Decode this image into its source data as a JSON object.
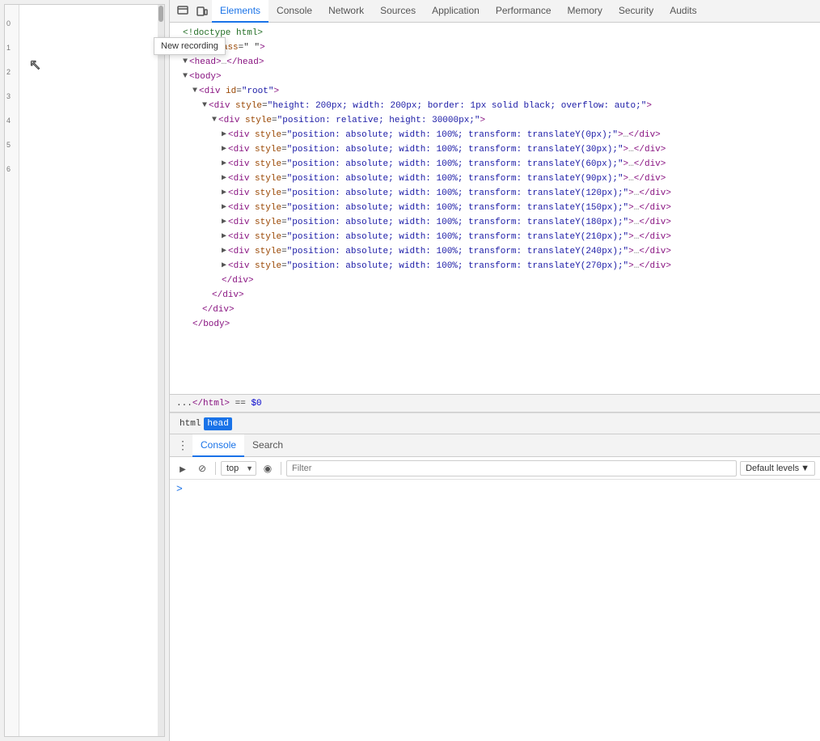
{
  "viewport": {
    "ruler_marks": [
      "0",
      "1",
      "2",
      "3",
      "4",
      "5",
      "6"
    ]
  },
  "tooltip": {
    "text": "New recording"
  },
  "devtools": {
    "tabs": [
      {
        "id": "elements",
        "label": "Elements",
        "active": true
      },
      {
        "id": "console",
        "label": "Console",
        "active": false
      },
      {
        "id": "network",
        "label": "Network",
        "active": false
      },
      {
        "id": "sources",
        "label": "Sources",
        "active": false
      },
      {
        "id": "application",
        "label": "Application",
        "active": false
      },
      {
        "id": "performance",
        "label": "Performance",
        "active": false
      },
      {
        "id": "memory",
        "label": "Memory",
        "active": false
      },
      {
        "id": "security",
        "label": "Security",
        "active": false
      },
      {
        "id": "audits",
        "label": "Audits",
        "active": false
      }
    ],
    "html_tree": [
      {
        "id": 0,
        "indent": 0,
        "arrow": "leaf",
        "content_type": "comment",
        "text": "<!doctype html>"
      },
      {
        "id": 1,
        "indent": 0,
        "arrow": "open",
        "content_type": "tag",
        "tag": "html",
        "attrs": [
          {
            "name": "class",
            "val": "\"\""
          }
        ]
      },
      {
        "id": 2,
        "indent": 1,
        "arrow": "open",
        "content_type": "tag",
        "tag": "head",
        "selfclose": false,
        "ellipsis": true
      },
      {
        "id": 3,
        "indent": 1,
        "arrow": "open",
        "content_type": "tag",
        "tag": "body",
        "attrs": []
      },
      {
        "id": 4,
        "indent": 2,
        "arrow": "open",
        "content_type": "tag",
        "tag": "div",
        "attrs": [
          {
            "name": "id",
            "val": "\"root\""
          }
        ]
      },
      {
        "id": 5,
        "indent": 3,
        "arrow": "open",
        "content_type": "tag",
        "tag": "div",
        "attrs": [
          {
            "name": "style",
            "val": "\"height: 200px; width: 200px; border: 1px solid black; overflow: auto;\""
          }
        ]
      },
      {
        "id": 6,
        "indent": 4,
        "arrow": "open",
        "content_type": "tag",
        "tag": "div",
        "attrs": [
          {
            "name": "style",
            "val": "\"position: relative; height: 30000px;\""
          }
        ]
      },
      {
        "id": 7,
        "indent": 5,
        "arrow": "closed",
        "content_type": "tag",
        "tag": "div",
        "attrs": [
          {
            "name": "style",
            "val": "\"position: absolute; width: 100%; transform: translateY(0px);\""
          }
        ],
        "ellipsis": true
      },
      {
        "id": 8,
        "indent": 5,
        "arrow": "closed",
        "content_type": "tag",
        "tag": "div",
        "attrs": [
          {
            "name": "style",
            "val": "\"position: absolute; width: 100%; transform: translateY(30px);\""
          }
        ],
        "ellipsis": true
      },
      {
        "id": 9,
        "indent": 5,
        "arrow": "closed",
        "content_type": "tag",
        "tag": "div",
        "attrs": [
          {
            "name": "style",
            "val": "\"position: absolute; width: 100%; transform: translateY(60px);\""
          }
        ],
        "ellipsis": true
      },
      {
        "id": 10,
        "indent": 5,
        "arrow": "closed",
        "content_type": "tag",
        "tag": "div",
        "attrs": [
          {
            "name": "style",
            "val": "\"position: absolute; width: 100%; transform: translateY(90px);\""
          }
        ],
        "ellipsis": true
      },
      {
        "id": 11,
        "indent": 5,
        "arrow": "closed",
        "content_type": "tag",
        "tag": "div",
        "attrs": [
          {
            "name": "style",
            "val": "\"position: absolute; width: 100%; transform: translateY(120px);\""
          }
        ],
        "ellipsis": true
      },
      {
        "id": 12,
        "indent": 5,
        "arrow": "closed",
        "content_type": "tag",
        "tag": "div",
        "attrs": [
          {
            "name": "style",
            "val": "\"position: absolute; width: 100%; transform: translateY(150px);\""
          }
        ],
        "ellipsis": true
      },
      {
        "id": 13,
        "indent": 5,
        "arrow": "closed",
        "content_type": "tag",
        "tag": "div",
        "attrs": [
          {
            "name": "style",
            "val": "\"position: absolute; width: 100%; transform: translateY(180px);\""
          }
        ],
        "ellipsis": true
      },
      {
        "id": 14,
        "indent": 5,
        "arrow": "closed",
        "content_type": "tag",
        "tag": "div",
        "attrs": [
          {
            "name": "style",
            "val": "\"position: absolute; width: 100%; transform: translateY(210px);\""
          }
        ],
        "ellipsis": true
      },
      {
        "id": 15,
        "indent": 5,
        "arrow": "closed",
        "content_type": "tag",
        "tag": "div",
        "attrs": [
          {
            "name": "style",
            "val": "\"position: absolute; width: 100%; transform: translateY(240px);\""
          }
        ],
        "ellipsis": true
      },
      {
        "id": 16,
        "indent": 5,
        "arrow": "closed",
        "content_type": "tag",
        "tag": "div",
        "attrs": [
          {
            "name": "style",
            "val": "\"position: absolute; width: 100%; transform: translateY(270px);\""
          }
        ],
        "ellipsis": true
      },
      {
        "id": 17,
        "indent": 4,
        "arrow": "leaf",
        "content_type": "closetag",
        "tag": "/div"
      },
      {
        "id": 18,
        "indent": 3,
        "arrow": "leaf",
        "content_type": "closetag",
        "tag": "/div"
      },
      {
        "id": 19,
        "indent": 2,
        "arrow": "leaf",
        "content_type": "closetag",
        "tag": "/div"
      },
      {
        "id": 20,
        "indent": 1,
        "arrow": "leaf",
        "content_type": "closetag",
        "tag": "/body"
      }
    ],
    "status_bar": {
      "text": "...</html>",
      "equals": "==",
      "dollar": "$0"
    },
    "breadcrumb": {
      "items": [
        {
          "id": "html",
          "label": "html",
          "active": false
        },
        {
          "id": "head",
          "label": "head",
          "active": true
        }
      ]
    },
    "bottom_tabs": [
      {
        "id": "console",
        "label": "Console",
        "active": true
      },
      {
        "id": "search",
        "label": "Search",
        "active": false
      }
    ],
    "console_toolbar": {
      "top_option": "top",
      "filter_placeholder": "Filter",
      "levels_label": "Default levels"
    }
  }
}
